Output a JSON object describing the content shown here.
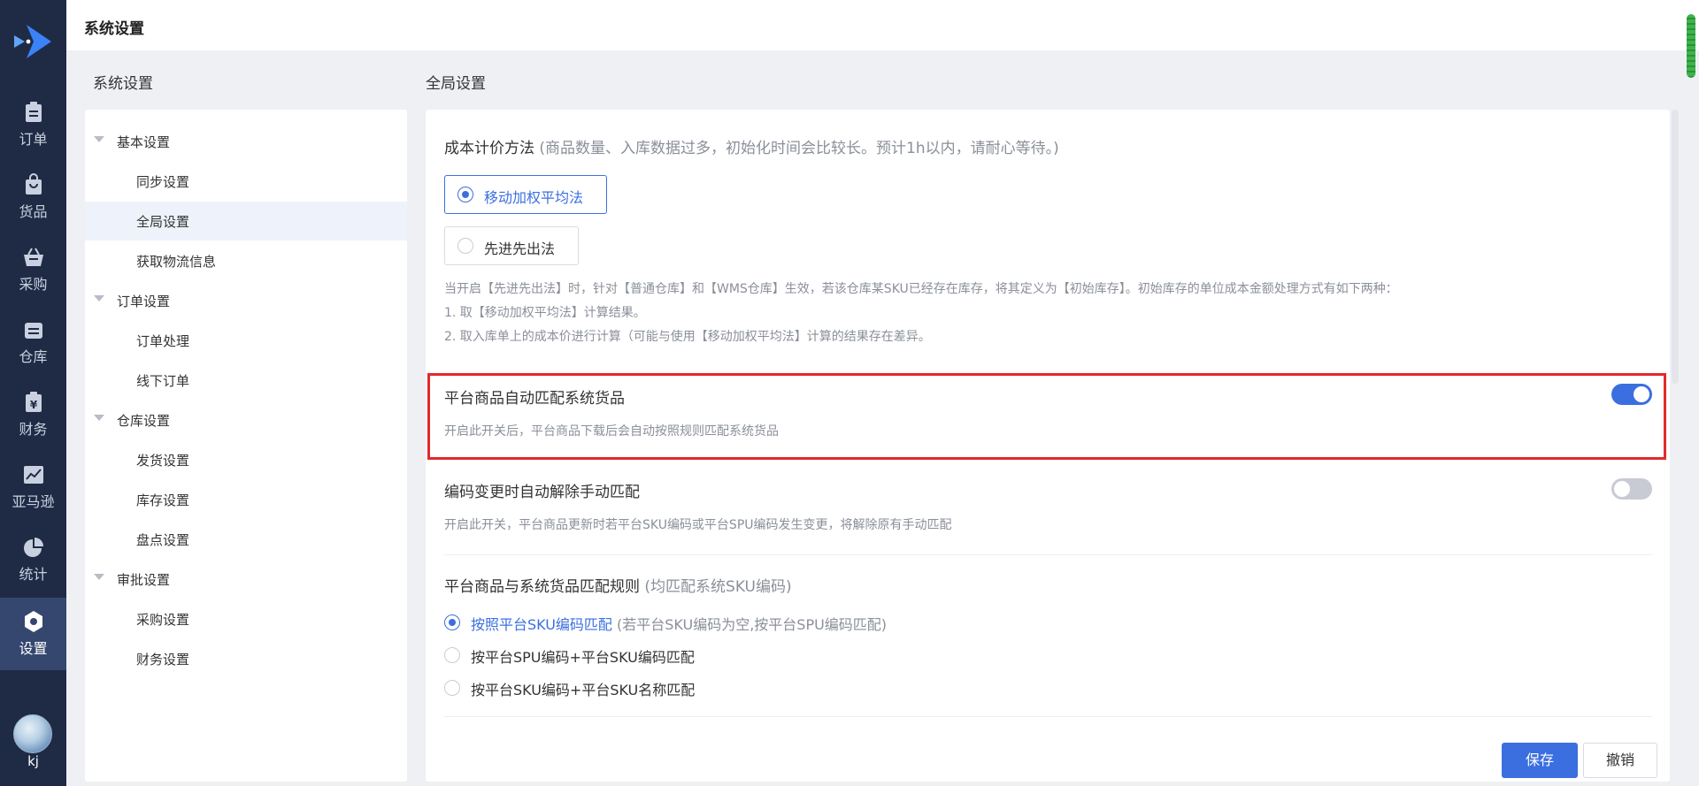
{
  "nav": {
    "items": [
      {
        "label": "订单",
        "icon": "order-clipboard-icon"
      },
      {
        "label": "货品",
        "icon": "goods-bag-icon"
      },
      {
        "label": "采购",
        "icon": "purchase-basket-icon"
      },
      {
        "label": "仓库",
        "icon": "warehouse-icon"
      },
      {
        "label": "财务",
        "icon": "finance-yen-icon"
      },
      {
        "label": "亚马逊",
        "icon": "amazon-trend-icon"
      },
      {
        "label": "统计",
        "icon": "stats-pie-icon"
      },
      {
        "label": "设置",
        "icon": "settings-gear-icon"
      }
    ],
    "active": "设置",
    "user_name": "kj"
  },
  "topbar": {
    "title": "系统设置"
  },
  "left_panel": {
    "heading": "系统设置",
    "groups": [
      {
        "label": "基本设置",
        "children": [
          "同步设置",
          "全局设置",
          "获取物流信息"
        ]
      },
      {
        "label": "订单设置",
        "children": [
          "订单处理",
          "线下订单"
        ]
      },
      {
        "label": "仓库设置",
        "children": [
          "发货设置",
          "库存设置",
          "盘点设置"
        ]
      },
      {
        "label": "审批设置",
        "children": [
          "采购设置",
          "财务设置"
        ]
      }
    ],
    "active_item": "全局设置"
  },
  "main": {
    "heading": "全局设置",
    "cost_method": {
      "title": "成本计价方法",
      "title_note": "(商品数量、入库数据过多，初始化时间会比较长。预计1h以内，请耐心等待。)",
      "options": [
        "移动加权平均法",
        "先进先出法"
      ],
      "selected": "移动加权平均法",
      "notes": [
        "当开启【先进先出法】时，针对【普通仓库】和【WMS仓库】生效，若该仓库某SKU已经存在库存，将其定义为【初始库存】。初始库存的单位成本金额处理方式有如下两种：",
        "1. 取【移动加权平均法】计算结果。",
        "2. 取入库单上的成本价进行计算（可能与使用【移动加权平均法】计算的结果存在差异。"
      ]
    },
    "auto_match": {
      "title": "平台商品自动匹配系统货品",
      "desc": "开启此开关后，平台商品下载后会自动按照规则匹配系统货品",
      "enabled": true
    },
    "auto_unmatch": {
      "title": "编码变更时自动解除手动匹配",
      "desc": "开启此开关，平台商品更新时若平台SKU编码或平台SPU编码发生变更，将解除原有手动匹配",
      "enabled": false
    },
    "match_rule": {
      "title": "平台商品与系统货品匹配规则",
      "title_note": "(均匹配系统SKU编码)",
      "options": [
        {
          "label": "按照平台SKU编码匹配",
          "sub": "(若平台SKU编码为空,按平台SPU编码匹配)"
        },
        {
          "label": "按平台SPU编码+平台SKU编码匹配",
          "sub": ""
        },
        {
          "label": "按平台SKU编码+平台SKU名称匹配",
          "sub": ""
        }
      ],
      "selected_index": 0
    },
    "buttons": {
      "save": "保存",
      "cancel": "撤销"
    }
  },
  "colors": {
    "nav_bg": "#1f2b45",
    "accent": "#3b6fe0",
    "highlight_border": "#e22a2a"
  }
}
